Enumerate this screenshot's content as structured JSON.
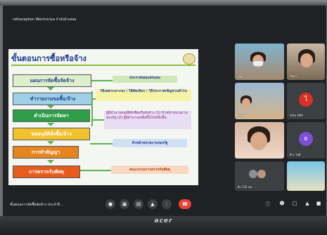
{
  "presenter": "rattanaphon Wechviriya กำลังนำเสนอ",
  "slide": {
    "title": "ขั้นตอนการซื้อหรือจ้าง",
    "steps": [
      "แผนการจัดซื้อจัดจ้าง",
      "ทำรายงานขอซื้อ/จ้าง",
      "ดำเนินการจัดหา",
      "ขออนุมัติสั่งซื้อ/จ้าง",
      "การทำสัญญา",
      "การตรวจรับพัสดุ"
    ],
    "notes": [
      "ประกาศเผยแพร่แผน",
      "วิธีเฉพาะเจาะจง / วิธีคัดเลือก / วิธีประกาศเชิญชวนทั่วไป",
      "ผู้มีอำนาจอนุมัติสั่งซื้อหรือสั่งจ้าง (1) หัวหน้าหน่วยงานของรัฐ (2) ผู้มีอำนาจเหนือขึ้นไปหนึ่งชั้น",
      "หัวหน้าหน่วยงานของรัฐ",
      "คณะกรรมการตรวจรับพัสดุ"
    ]
  },
  "participants": [
    {
      "name": "Sasi",
      "kind": "video"
    },
    {
      "name": "วิฑูรา",
      "kind": "video"
    },
    {
      "name": "จรรยา",
      "kind": "video"
    },
    {
      "name": "ไอริน O69",
      "kind": "avatar",
      "initial": "ไ",
      "color": "#d93025"
    },
    {
      "name": "",
      "kind": "video"
    },
    {
      "name": "ธีระ โชติ",
      "kind": "avatar",
      "initial": "ธ",
      "color": "#7b4fd6"
    },
    {
      "name": "อีก 135 คน",
      "kind": "more"
    },
    {
      "name": "",
      "kind": "video"
    }
  ],
  "meeting": {
    "title": "ขั้นตอนการจัดซื้อจัดจ้าง ประจำปี..."
  },
  "controls": {
    "mic_icon": "mic-icon",
    "camera_icon": "camera-icon",
    "captions_icon": "captions-icon",
    "present_icon": "present-icon",
    "more_icon": "more-icon",
    "end_icon": "end-call-icon"
  },
  "monitor_brand": "acer"
}
